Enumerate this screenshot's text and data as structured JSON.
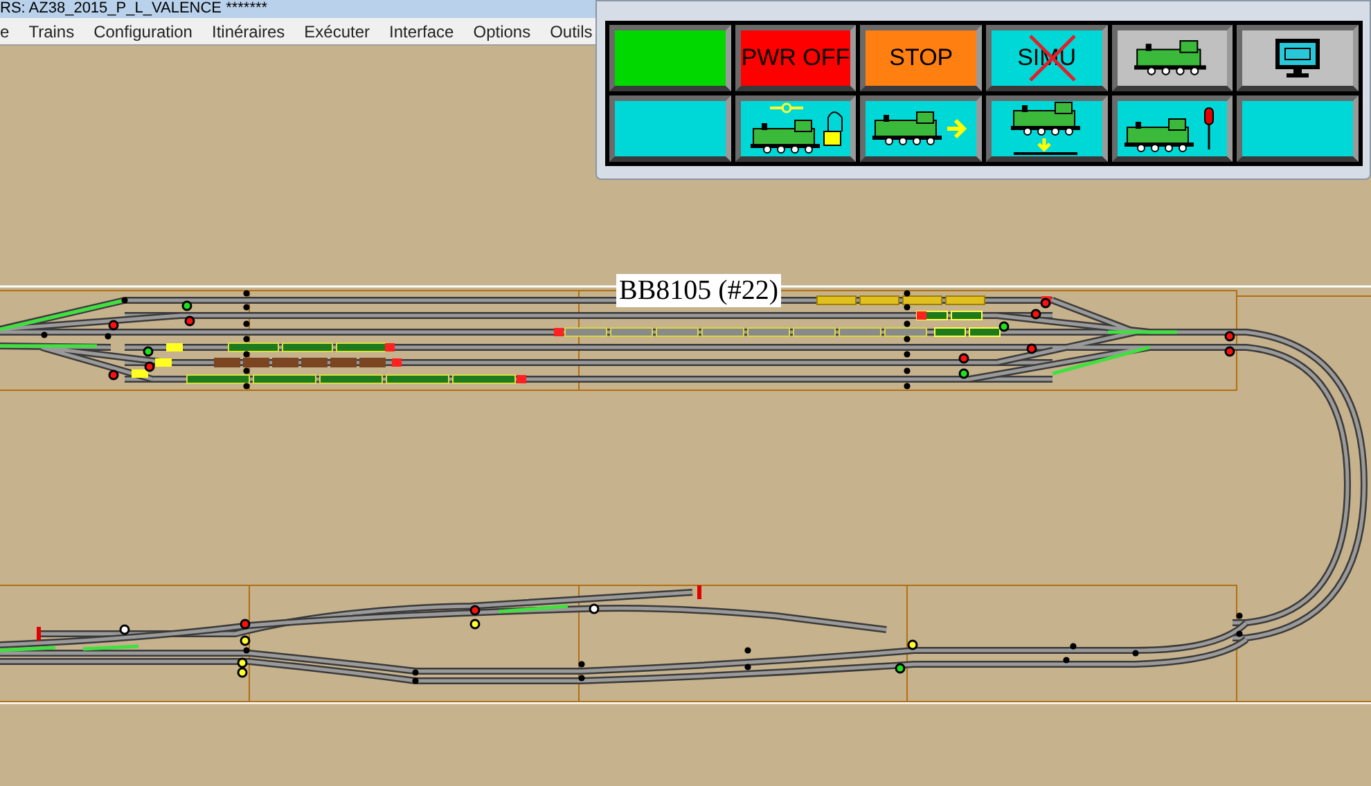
{
  "window": {
    "title": "RS: AZ38_2015_P_L_VALENCE *******"
  },
  "menu": [
    "e",
    "Trains",
    "Configuration",
    "Itinéraires",
    "Exécuter",
    "Interface",
    "Options",
    "Outils"
  ],
  "control_panel": {
    "buttons": [
      {
        "kind": "blank",
        "color": "#00d800"
      },
      {
        "kind": "text",
        "label": "PWR OFF",
        "color": "#ff0000"
      },
      {
        "kind": "text",
        "label": "STOP",
        "color": "#ff7f10"
      },
      {
        "kind": "text",
        "label": "SIMU",
        "color": "#00d8d8",
        "crossed": true
      },
      {
        "kind": "loco",
        "color": "#c0c0c0"
      },
      {
        "kind": "monitor",
        "color": "#c0c0c0"
      },
      {
        "kind": "blank",
        "color": "#00d8d8"
      },
      {
        "kind": "loco-lock",
        "color": "#00d8d8"
      },
      {
        "kind": "loco-arrow",
        "color": "#00d8d8"
      },
      {
        "kind": "loco-down",
        "color": "#00d8d8"
      },
      {
        "kind": "loco-signal",
        "color": "#00d8d8"
      },
      {
        "kind": "blank",
        "color": "#00d8d8"
      }
    ]
  },
  "train_label": "BB8105 (#22)"
}
